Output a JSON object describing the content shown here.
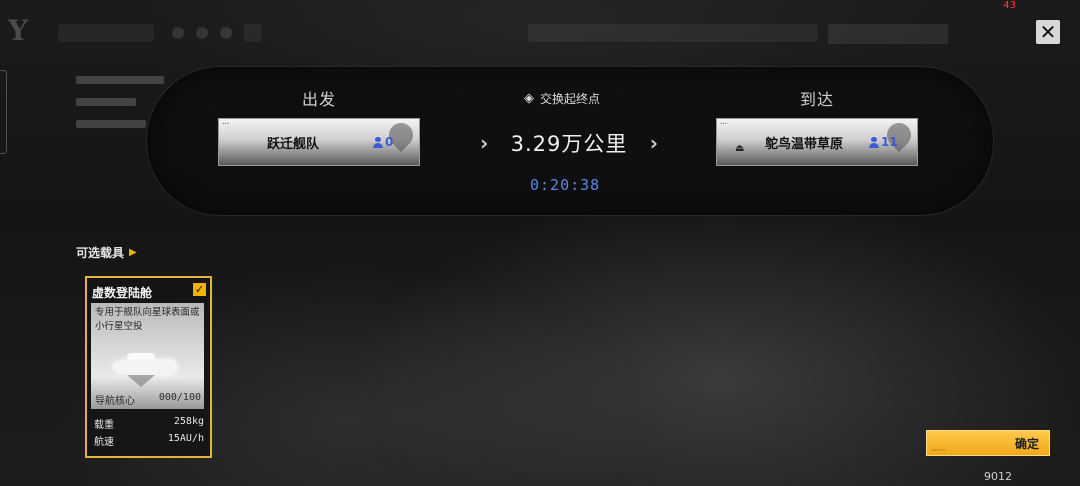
{
  "hud": {
    "fps": "43"
  },
  "route": {
    "departure_label": "出发",
    "arrival_label": "到达",
    "swap_label": "交换起终点",
    "distance": "3.29万公里",
    "eta": "0:20:38",
    "origin": {
      "name": "跃迁舰队",
      "population": "0"
    },
    "destination": {
      "name": "鸵鸟温带草原",
      "population": "11"
    }
  },
  "vehicles": {
    "title": "可选载具",
    "items": [
      {
        "name": "虚数登陆舱",
        "selected": true,
        "description": "专用于舰队向星球表面或小行星空投",
        "core_label": "导航核心",
        "core_value": "000/100",
        "load_label": "载重",
        "load_value": "258kg",
        "speed_label": "航速",
        "speed_value": "15AU/h"
      }
    ]
  },
  "actions": {
    "confirm_label": "确定"
  },
  "uid": "9012",
  "colors": {
    "accent": "#f0b400",
    "eta": "#5d86e6",
    "population": "#3b5bd1"
  }
}
